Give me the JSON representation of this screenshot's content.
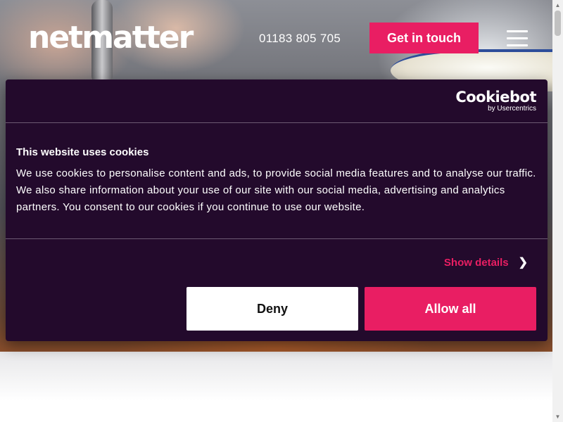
{
  "header": {
    "logo": "netmatter",
    "phone": "01183 805 705",
    "cta_label": "Get in touch",
    "menu_icon": "hamburger-icon"
  },
  "cookie_dialog": {
    "brand_name": "Cookiebot",
    "brand_sub": "by Usercentrics",
    "title": "This website uses cookies",
    "body": "We use cookies to personalise content and ads, to provide social media features and to analyse our traffic. We also share information about your use of our site with our social media, advertising and analytics partners. You consent to our cookies if you continue to use our website.",
    "show_details_label": "Show details",
    "deny_label": "Deny",
    "allow_label": "Allow all"
  },
  "colors": {
    "accent": "#e91e63",
    "dialog_bg": "#230a2c"
  }
}
